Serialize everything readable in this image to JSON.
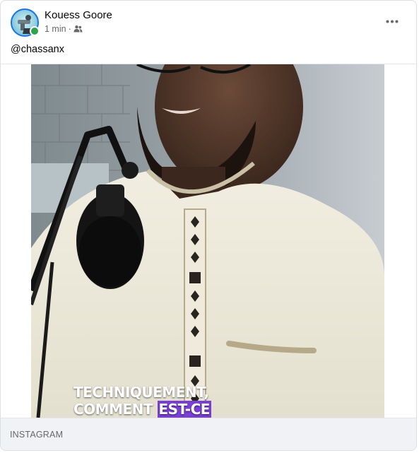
{
  "post": {
    "author": "Kouess Goore",
    "time": "1 min",
    "separator": "·",
    "audience_icon": "friends-icon",
    "caption": "@chassanx",
    "more_icon": "more-options-icon",
    "online": true
  },
  "video": {
    "subtitle_line1": "TECHNIQUEMENT,",
    "subtitle_line2_a": "COMMENT ",
    "subtitle_line2_b": "EST-CE",
    "highlight_color": "#7b3fd6"
  },
  "link_preview": {
    "source": "INSTAGRAM"
  }
}
